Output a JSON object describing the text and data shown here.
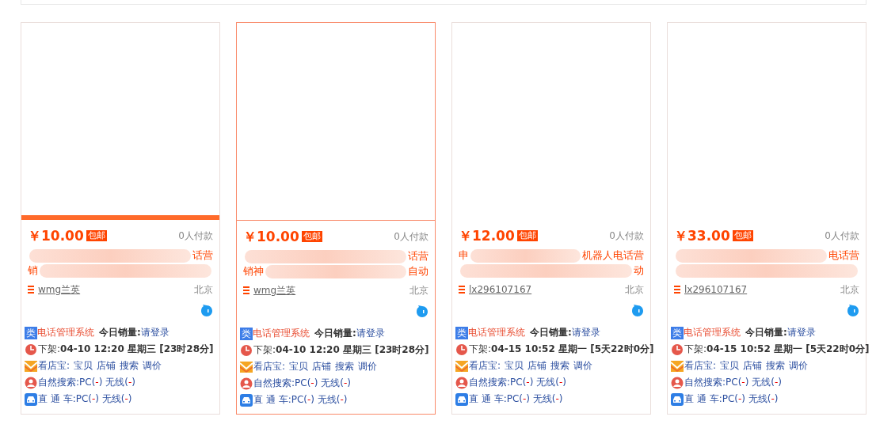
{
  "cards": [
    {
      "selected": false,
      "image_bar": true,
      "price": "￥10.00",
      "free_shipping": "包邮",
      "buyers": "0人付款",
      "title_lines": [
        {
          "end": "话营"
        },
        {
          "start": "销"
        }
      ],
      "seller": "wmg兰英",
      "location": "北京",
      "category_badge": "类",
      "category": "电话管理系统",
      "sales_label": "今日销量:",
      "sales_value": "请登录",
      "delist_label": "下架:",
      "delist_time": "04-10 12:20 星期三 [23时28分]",
      "tool_label": "看店宝:",
      "tool_links": [
        "宝贝",
        "店铺",
        "搜索",
        "调价"
      ],
      "natural": [
        {
          "kind": "label",
          "text": "自然搜索:PC("
        },
        {
          "kind": "value",
          "text": "-"
        },
        {
          "kind": "label",
          "text": ") 无线("
        },
        {
          "kind": "value",
          "text": "-"
        },
        {
          "kind": "label",
          "text": ")"
        }
      ],
      "ads": [
        {
          "kind": "label",
          "text": "直 通 车:PC("
        },
        {
          "kind": "value",
          "text": "-"
        },
        {
          "kind": "label",
          "text": ") 无线("
        },
        {
          "kind": "value",
          "text": "-"
        },
        {
          "kind": "label",
          "text": ")"
        }
      ]
    },
    {
      "selected": true,
      "image_bar": false,
      "price": "￥10.00",
      "free_shipping": "包邮",
      "buyers": "0人付款",
      "title_lines": [
        {
          "end": "话营"
        },
        {
          "start": "销神",
          "end": "自动"
        }
      ],
      "seller": "wmg兰英",
      "location": "北京",
      "category_badge": "类",
      "category": "电话管理系统",
      "sales_label": "今日销量:",
      "sales_value": "请登录",
      "delist_label": "下架:",
      "delist_time": "04-10 12:20 星期三 [23时28分]",
      "tool_label": "看店宝:",
      "tool_links": [
        "宝贝",
        "店铺",
        "搜索",
        "调价"
      ],
      "natural": [
        {
          "kind": "label",
          "text": "自然搜索:PC("
        },
        {
          "kind": "value",
          "text": "-"
        },
        {
          "kind": "label",
          "text": ") 无线("
        },
        {
          "kind": "value",
          "text": "-"
        },
        {
          "kind": "label",
          "text": ")"
        }
      ],
      "ads": [
        {
          "kind": "label",
          "text": "直 通 车:PC("
        },
        {
          "kind": "value",
          "text": "-"
        },
        {
          "kind": "label",
          "text": ") 无线("
        },
        {
          "kind": "value",
          "text": "-"
        },
        {
          "kind": "label",
          "text": ")"
        }
      ]
    },
    {
      "selected": false,
      "image_bar": false,
      "price": "￥12.00",
      "free_shipping": "包邮",
      "buyers": "0人付款",
      "title_lines": [
        {
          "start": "申",
          "end": "机器人电话营"
        },
        {
          "end": "动"
        }
      ],
      "seller": "lx296107167",
      "location": "北京",
      "category_badge": "类",
      "category": "电话管理系统",
      "sales_label": "今日销量:",
      "sales_value": "请登录",
      "delist_label": "下架:",
      "delist_time": "04-15 10:52 星期一 [5天22时0分]",
      "tool_label": "看店宝:",
      "tool_links": [
        "宝贝",
        "店铺",
        "搜索",
        "调价"
      ],
      "natural": [
        {
          "kind": "label",
          "text": "自然搜索:PC("
        },
        {
          "kind": "value",
          "text": "-"
        },
        {
          "kind": "label",
          "text": ") 无线("
        },
        {
          "kind": "value",
          "text": "-"
        },
        {
          "kind": "label",
          "text": ")"
        }
      ],
      "ads": [
        {
          "kind": "label",
          "text": "直 通 车:PC("
        },
        {
          "kind": "value",
          "text": "-"
        },
        {
          "kind": "label",
          "text": ") 无线("
        },
        {
          "kind": "value",
          "text": "-"
        },
        {
          "kind": "label",
          "text": ")"
        }
      ]
    },
    {
      "selected": false,
      "image_bar": false,
      "price": "￥33.00",
      "free_shipping": "包邮",
      "buyers": "0人付款",
      "title_lines": [
        {
          "end": "电话营"
        }
      ],
      "seller": "lx296107167",
      "location": "北京",
      "category_badge": "类",
      "category": "电话管理系统",
      "sales_label": "今日销量:",
      "sales_value": "请登录",
      "delist_label": "下架:",
      "delist_time": "04-15 10:52 星期一 [5天22时0分]",
      "tool_label": "看店宝:",
      "tool_links": [
        "宝贝",
        "店铺",
        "搜索",
        "调价"
      ],
      "natural": [
        {
          "kind": "label",
          "text": "自然搜索:PC("
        },
        {
          "kind": "value",
          "text": "-"
        },
        {
          "kind": "label",
          "text": ") 无线("
        },
        {
          "kind": "value",
          "text": "-"
        },
        {
          "kind": "label",
          "text": ")"
        }
      ],
      "ads": [
        {
          "kind": "label",
          "text": "直 通 车:PC("
        },
        {
          "kind": "value",
          "text": "-"
        },
        {
          "kind": "label",
          "text": ") 无线("
        },
        {
          "kind": "value",
          "text": "-"
        },
        {
          "kind": "label",
          "text": ")"
        }
      ]
    }
  ]
}
